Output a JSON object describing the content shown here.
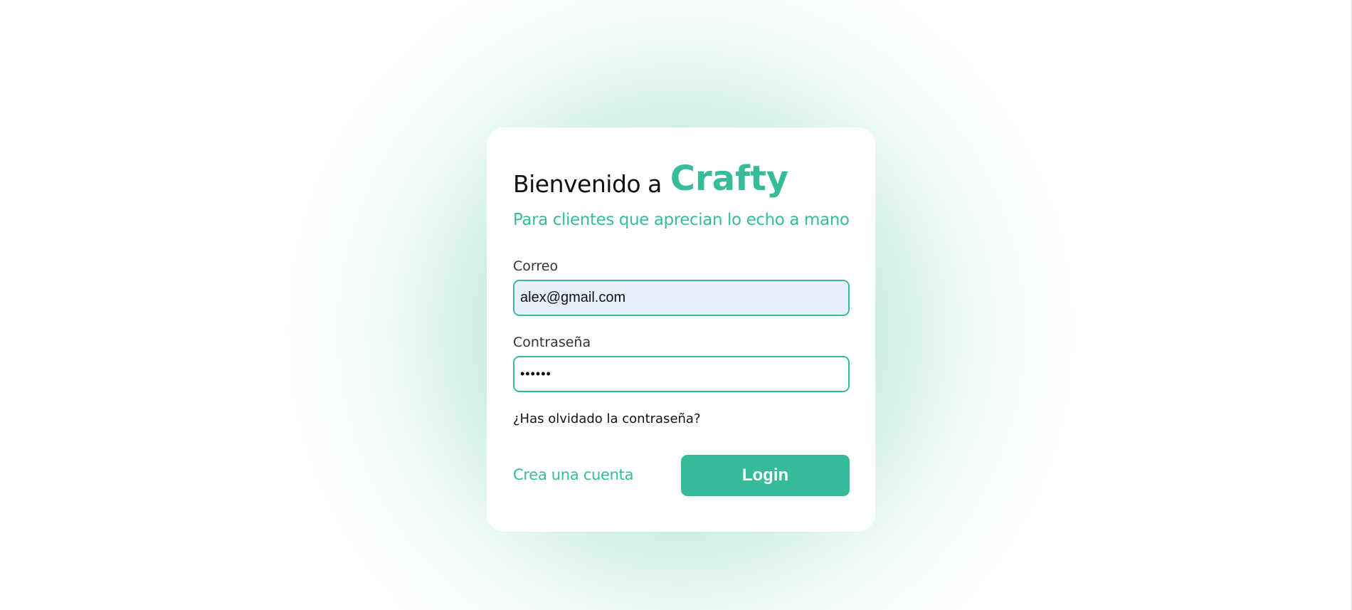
{
  "welcome": {
    "text": "Bienvenido a",
    "brand": "Crafty",
    "subtitle": "Para clientes que aprecian lo echo a mano"
  },
  "form": {
    "email_label": "Correo",
    "email_value": "alex@gmail.com",
    "password_label": "Contraseña",
    "password_value": "••••••",
    "forgot_link": "¿Has olvidado la contraseña?",
    "create_account_link": "Crea una cuenta",
    "login_button": "Login"
  },
  "colors": {
    "accent": "#38bb9b",
    "autofill_bg": "#e8f0fe",
    "text": "#111111"
  },
  "icons": {
    "logo_hammer": "hammer-icon"
  }
}
